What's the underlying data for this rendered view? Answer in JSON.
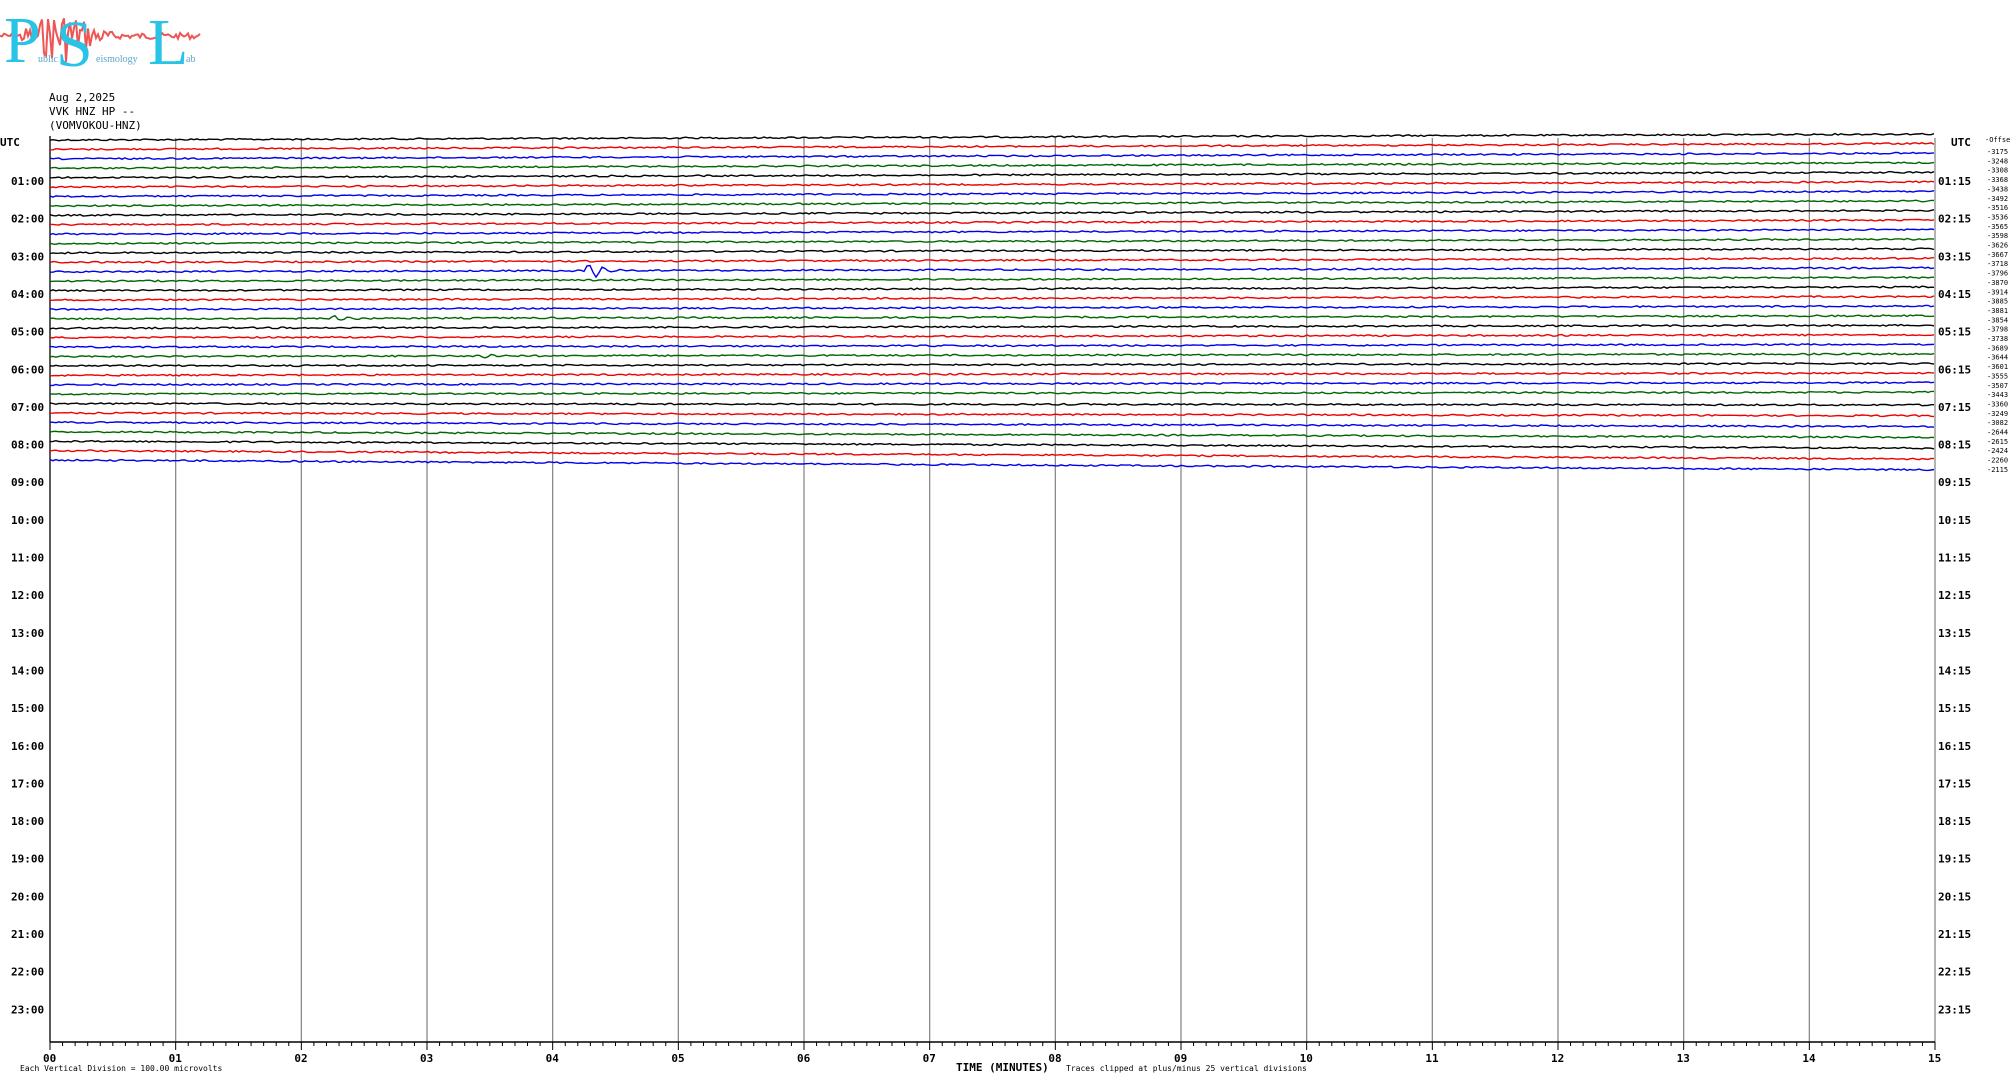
{
  "logo": {
    "letter_p": "P",
    "letter_s": "S",
    "letter_l": "L",
    "word_1": "ublic",
    "word_2": "eismology",
    "word_3": "ab",
    "color_letters": "#29c3e6",
    "color_waves": "#ee5555"
  },
  "header": {
    "date": "Aug 2,2025",
    "station": "VVK HNZ HP --",
    "location": "(VOMVOKOU-HNZ)"
  },
  "axes": {
    "left_title": "UTC",
    "right_title": "UTC",
    "left_labels": [
      "01:00",
      "02:00",
      "03:00",
      "04:00",
      "05:00",
      "06:00",
      "07:00",
      "08:00",
      "09:00",
      "10:00",
      "11:00",
      "12:00",
      "13:00",
      "14:00",
      "15:00",
      "16:00",
      "17:00",
      "18:00",
      "19:00",
      "20:00",
      "21:00",
      "22:00",
      "23:00"
    ],
    "right_labels": [
      "01:15",
      "02:15",
      "03:15",
      "04:15",
      "05:15",
      "06:15",
      "07:15",
      "08:15",
      "09:15",
      "10:15",
      "11:15",
      "12:15",
      "13:15",
      "14:15",
      "15:15",
      "16:15",
      "17:15",
      "18:15",
      "19:15",
      "20:15",
      "21:15",
      "22:15",
      "23:15"
    ],
    "x_ticks": [
      "00",
      "01",
      "02",
      "03",
      "04",
      "05",
      "06",
      "07",
      "08",
      "09",
      "10",
      "11",
      "12",
      "13",
      "14",
      "15"
    ],
    "x_title": "TIME (MINUTES)"
  },
  "footer": {
    "scale_note": "Each Vertical Division = 100.00 microvolts",
    "clip_note": "Traces clipped at plus/minus 25 vertical divisions"
  },
  "chart_data": {
    "type": "line",
    "title": "",
    "xlabel": "TIME (MINUTES)",
    "ylabel": "UTC",
    "xlim": [
      0,
      15
    ],
    "ylim_hours": [
      0,
      24
    ],
    "trace_interval_minutes": 15,
    "trace_colors": [
      "#000000",
      "#ee0000",
      "#0000ee",
      "#006600"
    ],
    "grid": true,
    "offsets_label_first": "-Offset",
    "offsets": [
      "-3175",
      "-3248",
      "-3308",
      "-3368",
      "-3438",
      "-3492",
      "-3516",
      "-3536",
      "-3565",
      "-3598",
      "-3626",
      "-3667",
      "-3718",
      "-3796",
      "-3870",
      "-3914",
      "-3885",
      "-3881",
      "-3854",
      "-3798",
      "-3738",
      "-3689",
      "-3644",
      "-3601",
      "-3555",
      "-3507",
      "-3443",
      "-3360",
      "-3249",
      "-3082",
      "-2644",
      "-2615",
      "-2424",
      "-2260",
      "-2115"
    ],
    "events": [
      {
        "trace": 14,
        "minute": 4.35,
        "amplitude": 6
      },
      {
        "trace": 19,
        "minute": 2.3,
        "amplitude": 2.5
      },
      {
        "trace": 23,
        "minute": 3.5,
        "amplitude": 1.5
      }
    ]
  }
}
